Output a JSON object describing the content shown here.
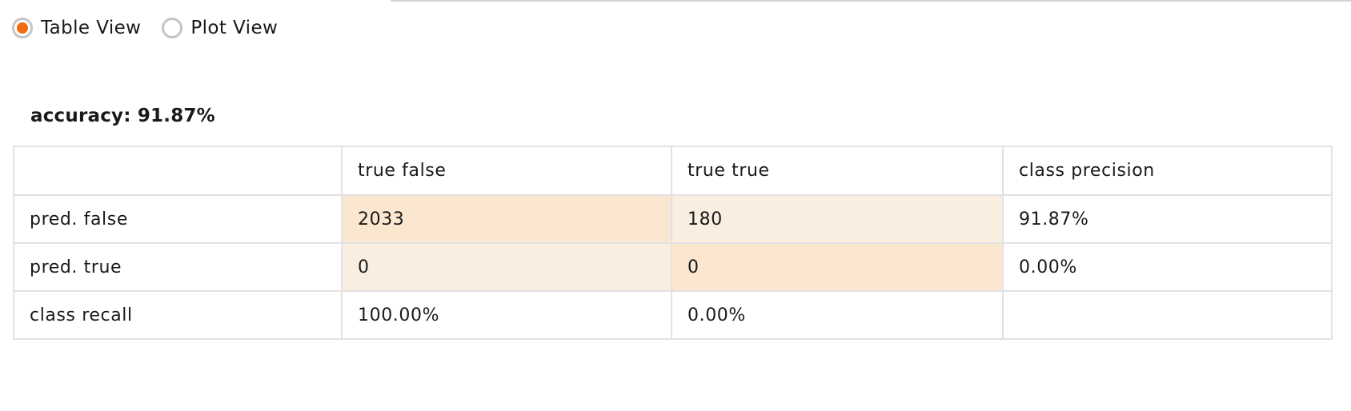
{
  "view_toggle": {
    "options": [
      {
        "label": "Table View",
        "selected": true
      },
      {
        "label": "Plot View",
        "selected": false
      }
    ]
  },
  "accuracy_label": "accuracy: 91.87%",
  "matrix": {
    "header": [
      "",
      "true false",
      "true true",
      "class precision"
    ],
    "rows": [
      {
        "label": "pred. false",
        "cells": [
          "2033",
          "180",
          "91.87%"
        ]
      },
      {
        "label": "pred. true",
        "cells": [
          "0",
          "0",
          "0.00%"
        ]
      },
      {
        "label": "class recall",
        "cells": [
          "100.00%",
          "0.00%",
          ""
        ]
      }
    ]
  },
  "colors": {
    "accent": "#f16a14",
    "diagonal_cell": "#fbe7d0",
    "off_diagonal_cell": "#f9eee0",
    "border": "#e2e2e2"
  }
}
